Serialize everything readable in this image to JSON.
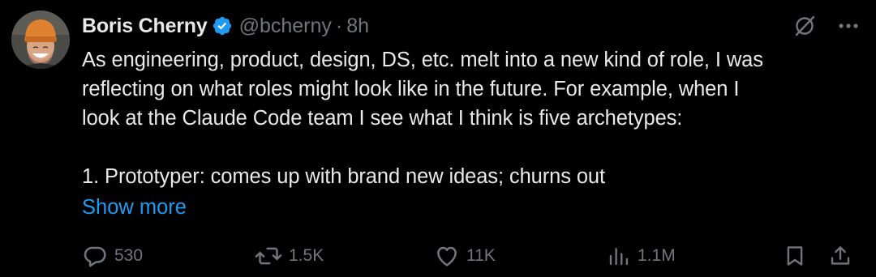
{
  "author": {
    "display_name": "Boris Cherny",
    "handle": "@bcherny",
    "separator": "·",
    "time": "8h"
  },
  "colors": {
    "background": "#000000",
    "text": "#e7e9ea",
    "muted": "#71767b",
    "accent": "#1d9bf0"
  },
  "post": {
    "lines": [
      "As engineering, product, design, DS, etc. melt into a new kind of role, I was",
      "reflecting on what roles might look like in the future. For example, when I",
      "look at the Claude Code team I see what I think is five archetypes:",
      "",
      "1. Prototyper: comes up with brand new ideas; churns out"
    ],
    "show_more": "Show more"
  },
  "actions": {
    "replies": "530",
    "reposts": "1.5K",
    "likes": "11K",
    "views": "1.1M"
  },
  "icons": {
    "verified": "verified-badge-icon",
    "grok": "grok-icon",
    "more": "more-icon",
    "reply": "reply-icon",
    "repost": "repost-icon",
    "like": "heart-icon",
    "views": "views-icon",
    "bookmark": "bookmark-icon",
    "share": "share-icon"
  }
}
